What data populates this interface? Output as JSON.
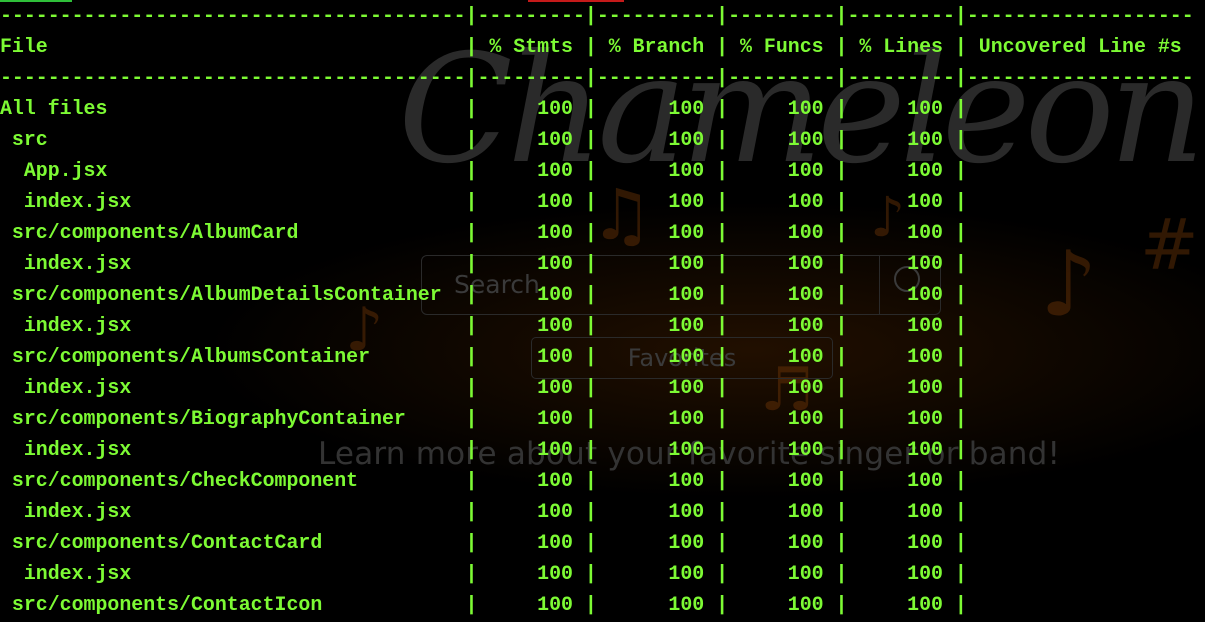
{
  "background": {
    "logo_text": "Chameleon",
    "search_placeholder": "Search",
    "favorites_label": "Favorites",
    "tagline": "Learn more about your favorite singer or band!",
    "colors": {
      "terminal_text": "#7dfa34",
      "background": "#000000",
      "top_strip_left": "#2fbf3a",
      "top_strip_mid": "#c51a1a"
    }
  },
  "terminal": {
    "lines": [
      "---------------------------------------|---------|----------|---------|---------|-------------------",
      "File                                   | % Stmts | % Branch | % Funcs | % Lines | Uncovered Line #s ",
      "---------------------------------------|---------|----------|---------|---------|-------------------",
      "All files                              |     100 |      100 |     100 |     100 |                   ",
      " src                                   |     100 |      100 |     100 |     100 |                   ",
      "  App.jsx                              |     100 |      100 |     100 |     100 |                   ",
      "  index.jsx                            |     100 |      100 |     100 |     100 |                   ",
      " src/components/AlbumCard              |     100 |      100 |     100 |     100 |                   ",
      "  index.jsx                            |     100 |      100 |     100 |     100 |                   ",
      " src/components/AlbumDetailsContainer  |     100 |      100 |     100 |     100 |                   ",
      "  index.jsx                            |     100 |      100 |     100 |     100 |                   ",
      " src/components/AlbumsContainer        |     100 |      100 |     100 |     100 |                   ",
      "  index.jsx                            |     100 |      100 |     100 |     100 |                   ",
      " src/components/BiographyContainer     |     100 |      100 |     100 |     100 |                   ",
      "  index.jsx                            |     100 |      100 |     100 |     100 |                   ",
      " src/components/CheckComponent         |     100 |      100 |     100 |     100 |                   ",
      "  index.jsx                            |     100 |      100 |     100 |     100 |                   ",
      " src/components/ContactCard            |     100 |      100 |     100 |     100 |                   ",
      "  index.jsx                            |     100 |      100 |     100 |     100 |                   ",
      " src/components/ContactIcon            |     100 |      100 |     100 |     100 |                   "
    ]
  }
}
